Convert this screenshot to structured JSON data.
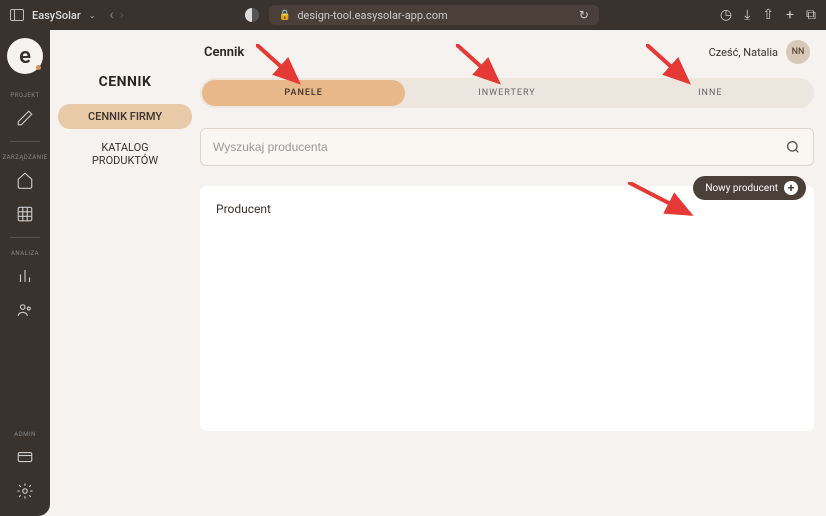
{
  "browser": {
    "site_name": "EasySolar",
    "url": "design-tool.easysolar-app.com"
  },
  "header": {
    "page_title": "Cennik",
    "greeting": "Cześć, Natalia",
    "avatar_initials": "NN"
  },
  "secondary_nav": {
    "title": "CENNIK",
    "items": [
      {
        "label": "CENNIK FIRMY",
        "active": true
      },
      {
        "label": "KATALOG PRODUKTÓW",
        "active": false
      }
    ]
  },
  "tabs": [
    {
      "label": "PANELE",
      "active": true
    },
    {
      "label": "INWERTERY",
      "active": false
    },
    {
      "label": "INNE",
      "active": false
    }
  ],
  "search": {
    "placeholder": "Wyszukaj producenta",
    "value": ""
  },
  "panel": {
    "title": "Producent",
    "new_button_label": "Nowy producent"
  },
  "sidebar": {
    "sections": [
      {
        "label": "PROJEKT"
      },
      {
        "label": "ZARZĄDZANIE"
      },
      {
        "label": "ANALIZA"
      },
      {
        "label": "ADMIN"
      }
    ]
  }
}
